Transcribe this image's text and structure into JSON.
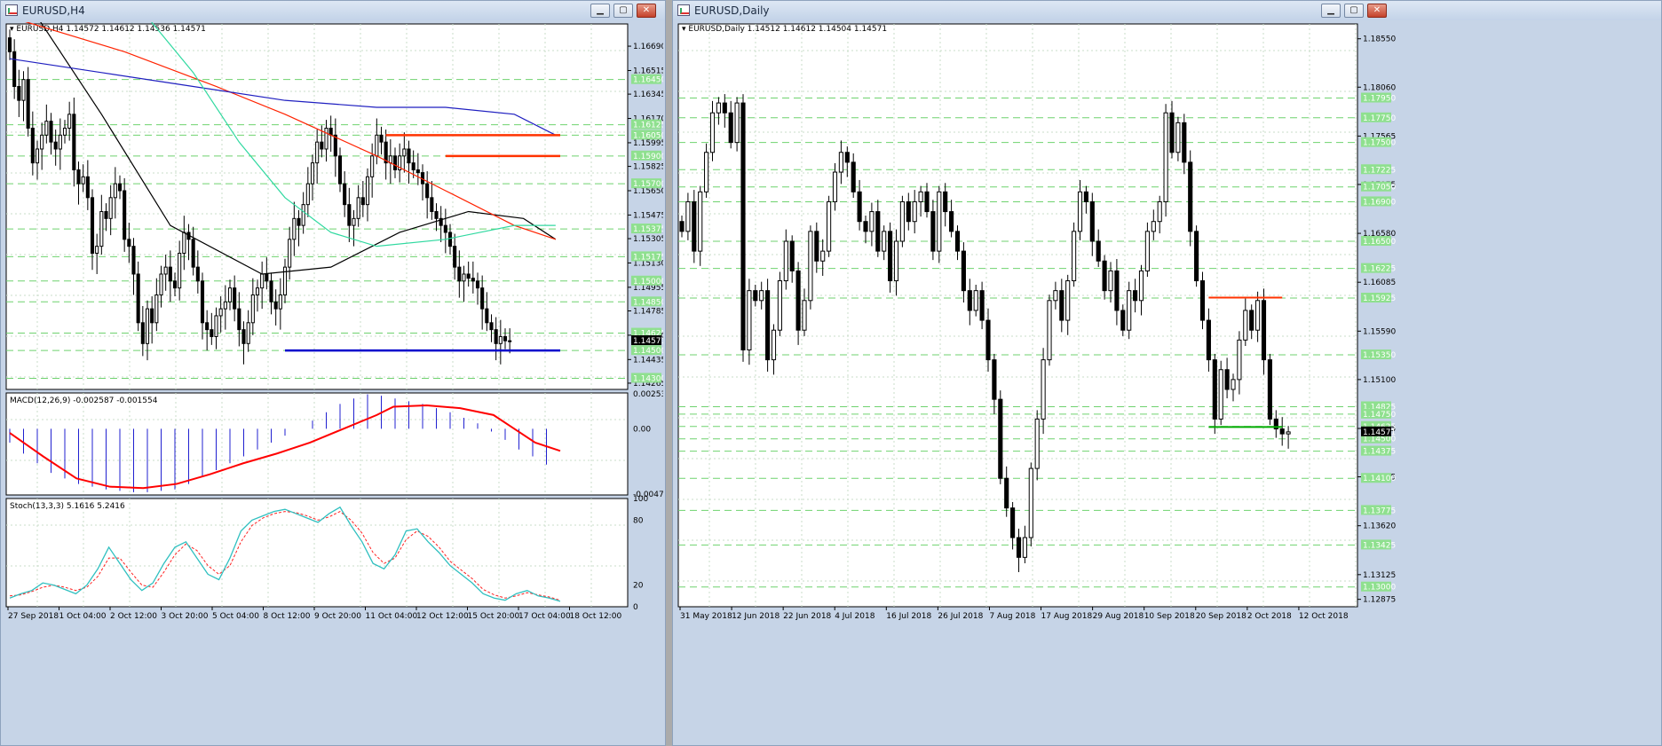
{
  "windows": [
    {
      "title": "EURUSD,H4",
      "min_symbol": "▁",
      "max_symbol": "▢",
      "close_symbol": "✕"
    },
    {
      "title": "EURUSD,Daily",
      "min_symbol": "▁",
      "max_symbol": "▢",
      "close_symbol": "✕"
    }
  ],
  "chart_data": [
    {
      "type": "candlestick",
      "title": "EURUSD,H4  1.14572 1.14612 1.14536 1.14571",
      "symbol": "EURUSD",
      "timeframe": "H4",
      "ohlc_last": {
        "open": 1.14572,
        "high": 1.14612,
        "low": 1.14536,
        "close": 1.14571
      },
      "ylim": [
        1.1422,
        1.1685
      ],
      "price_ticks": [
        "1.16690",
        "1.16515",
        "1.16345",
        "1.16170",
        "1.15995",
        "1.15825",
        "1.15650",
        "1.15475",
        "1.15305",
        "1.15130",
        "1.14955",
        "1.14785",
        "1.14610",
        "1.14435",
        "1.14265"
      ],
      "level_labels": [
        "1.16450",
        "1.16125",
        "1.16050",
        "1.15900",
        "1.15700",
        "1.15375",
        "1.15175",
        "1.15000",
        "1.14850",
        "1.14625",
        "1.14500",
        "1.14300"
      ],
      "current_price": "1.14571",
      "x_labels": [
        "27 Sep 2018",
        "1 Oct 04:00",
        "2 Oct 12:00",
        "3 Oct 20:00",
        "5 Oct 04:00",
        "8 Oct 12:00",
        "9 Oct 20:00",
        "11 Oct 04:00",
        "12 Oct 12:00",
        "15 Oct 20:00",
        "17 Oct 04:00",
        "18 Oct 12:00"
      ],
      "bar_count": 120,
      "candles_close": [
        1.1665,
        1.164,
        1.163,
        1.1645,
        1.161,
        1.1585,
        1.1595,
        1.1605,
        1.1615,
        1.16,
        1.1595,
        1.1605,
        1.161,
        1.162,
        1.158,
        1.157,
        1.1575,
        1.156,
        1.152,
        1.1525,
        1.155,
        1.1545,
        1.156,
        1.157,
        1.1565,
        1.153,
        1.1525,
        1.1505,
        1.147,
        1.1455,
        1.148,
        1.147,
        1.149,
        1.1505,
        1.151,
        1.15,
        1.1495,
        1.152,
        1.1535,
        1.153,
        1.151,
        1.15,
        1.147,
        1.1465,
        1.146,
        1.1475,
        1.148,
        1.1485,
        1.1495,
        1.148,
        1.1465,
        1.1455,
        1.147,
        1.149,
        1.1495,
        1.1505,
        1.15,
        1.1485,
        1.148,
        1.149,
        1.151,
        1.153,
        1.1545,
        1.154,
        1.1555,
        1.157,
        1.1585,
        1.16,
        1.1595,
        1.161,
        1.1605,
        1.159,
        1.157,
        1.1555,
        1.154,
        1.1545,
        1.156,
        1.1555,
        1.1575,
        1.159,
        1.1605,
        1.16,
        1.1585,
        1.159,
        1.158,
        1.159,
        1.1595,
        1.1585,
        1.158,
        1.1578,
        1.157,
        1.156,
        1.155,
        1.1545,
        1.154,
        1.1535,
        1.1525,
        1.151,
        1.15,
        1.1505,
        1.1502,
        1.15,
        1.1495,
        1.148,
        1.147,
        1.1465,
        1.1455,
        1.146,
        1.1457,
        1.1457
      ],
      "overlays": [
        {
          "name": "MA black",
          "color": "#000000",
          "points": [
            [
              0,
              1.172
            ],
            [
              20,
              1.162
            ],
            [
              35,
              1.154
            ],
            [
              55,
              1.1505
            ],
            [
              70,
              1.151
            ],
            [
              85,
              1.1535
            ],
            [
              100,
              1.155
            ],
            [
              112,
              1.1545
            ],
            [
              119,
              1.153
            ]
          ]
        },
        {
          "name": "MA red",
          "color": "#ff2200",
          "points": [
            [
              0,
              1.169
            ],
            [
              25,
              1.1665
            ],
            [
              45,
              1.164
            ],
            [
              60,
              1.162
            ],
            [
              80,
              1.159
            ],
            [
              95,
              1.1565
            ],
            [
              110,
              1.154
            ],
            [
              119,
              1.153
            ]
          ]
        },
        {
          "name": "MA blue",
          "color": "#1f1fc0",
          "points": [
            [
              0,
              1.166
            ],
            [
              20,
              1.165
            ],
            [
              40,
              1.164
            ],
            [
              60,
              1.163
            ],
            [
              80,
              1.1625
            ],
            [
              95,
              1.1625
            ],
            [
              110,
              1.162
            ],
            [
              119,
              1.1605
            ]
          ]
        },
        {
          "name": "MA green",
          "color": "#30d9a0",
          "points": [
            [
              30,
              1.169
            ],
            [
              40,
              1.165
            ],
            [
              50,
              1.16
            ],
            [
              60,
              1.156
            ],
            [
              70,
              1.1535
            ],
            [
              80,
              1.1525
            ],
            [
              95,
              1.153
            ],
            [
              110,
              1.154
            ],
            [
              119,
              1.154
            ]
          ]
        }
      ],
      "hlines": [
        {
          "price": 1.1605,
          "from": 82,
          "to": 120,
          "color": "#ff3300"
        },
        {
          "price": 1.159,
          "from": 95,
          "to": 120,
          "color": "#ff3300"
        },
        {
          "price": 1.145,
          "from": 60,
          "to": 120,
          "color": "#0000cc"
        }
      ]
    },
    {
      "type": "histogram+line",
      "title": "MACD(12,26,9) -0.002587 -0.001554",
      "ylim": [
        -0.0048,
        0.0026
      ],
      "y_ticks": [
        "0.002531",
        "0.00",
        "-0.004734"
      ],
      "histogram": [
        -0.001,
        -0.0018,
        -0.0025,
        -0.0032,
        -0.0036,
        -0.004,
        -0.0042,
        -0.0044,
        -0.0045,
        -0.0046,
        -0.0046,
        -0.0045,
        -0.0044,
        -0.004,
        -0.0035,
        -0.003,
        -0.0025,
        -0.002,
        -0.0015,
        -0.001,
        -0.0005,
        0.0,
        0.0006,
        0.0012,
        0.0018,
        0.0022,
        0.0025,
        0.0024,
        0.0022,
        0.002,
        0.0018,
        0.0015,
        0.0012,
        0.0008,
        0.0004,
        -0.0002,
        -0.0008,
        -0.0015,
        -0.002,
        -0.0026
      ],
      "signal_points": [
        [
          0,
          -0.0003
        ],
        [
          4,
          -0.002
        ],
        [
          8,
          -0.0036
        ],
        [
          12,
          -0.0042
        ],
        [
          16,
          -0.0043
        ],
        [
          20,
          -0.004
        ],
        [
          24,
          -0.0033
        ],
        [
          28,
          -0.0025
        ],
        [
          32,
          -0.0018
        ],
        [
          36,
          -0.001
        ],
        [
          40,
          0.0
        ],
        [
          44,
          0.001
        ],
        [
          46,
          0.0016
        ],
        [
          50,
          0.0017
        ],
        [
          54,
          0.0015
        ],
        [
          58,
          0.001
        ],
        [
          60,
          0.0002
        ],
        [
          63,
          -0.001
        ],
        [
          66,
          -0.0016
        ]
      ],
      "signal_color": "#ff0000",
      "hist_color": "#2020d0"
    },
    {
      "type": "line",
      "title": "Stoch(13,3,3) 5.1616 5.2416",
      "ylim": [
        0,
        100
      ],
      "y_ticks": [
        "100",
        "80",
        "20",
        "0"
      ],
      "k_color": "#30c0c0",
      "d_color": "#ff2020",
      "k": [
        8,
        12,
        15,
        22,
        20,
        16,
        12,
        20,
        35,
        55,
        40,
        25,
        15,
        22,
        40,
        55,
        60,
        45,
        30,
        25,
        45,
        70,
        80,
        84,
        88,
        90,
        86,
        82,
        78,
        86,
        92,
        75,
        60,
        40,
        35,
        48,
        70,
        72,
        60,
        50,
        38,
        30,
        22,
        12,
        8,
        6,
        12,
        15,
        10,
        8,
        5
      ],
      "d": [
        10,
        11,
        14,
        18,
        20,
        18,
        15,
        18,
        28,
        45,
        45,
        32,
        20,
        18,
        32,
        48,
        58,
        52,
        38,
        30,
        38,
        60,
        75,
        82,
        86,
        88,
        87,
        84,
        80,
        83,
        88,
        80,
        68,
        50,
        40,
        45,
        62,
        70,
        65,
        55,
        42,
        34,
        26,
        16,
        11,
        8,
        10,
        13,
        11,
        9,
        6
      ]
    },
    {
      "type": "candlestick",
      "title": "EURUSD,Daily  1.14512 1.14612 1.14504 1.14571",
      "symbol": "EURUSD",
      "timeframe": "Daily",
      "ohlc_last": {
        "open": 1.14512,
        "high": 1.14612,
        "low": 1.14504,
        "close": 1.14571
      },
      "ylim": [
        1.128,
        1.187
      ],
      "price_ticks": [
        "1.18550",
        "1.18060",
        "1.17565",
        "1.17075",
        "1.16580",
        "1.16085",
        "1.15590",
        "1.15100",
        "1.14605",
        "1.14115",
        "1.13620",
        "1.13125",
        "1.12875"
      ],
      "level_labels": [
        "1.17950",
        "1.17750",
        "1.17500",
        "1.17225",
        "1.17050",
        "1.16900",
        "1.16500",
        "1.16225",
        "1.15925",
        "1.15350",
        "1.14825",
        "1.14750",
        "1.14625",
        "1.14500",
        "1.14375",
        "1.14100",
        "1.13775",
        "1.13425",
        "1.13000"
      ],
      "current_price": "1.14571",
      "x_labels": [
        "31 May 2018",
        "12 Jun 2018",
        "22 Jun 2018",
        "4 Jul 2018",
        "16 Jul 2018",
        "26 Jul 2018",
        "7 Aug 2018",
        "17 Aug 2018",
        "29 Aug 2018",
        "10 Sep 2018",
        "20 Sep 2018",
        "2 Oct 2018",
        "12 Oct 2018"
      ],
      "bar_count": 100,
      "candles_close": [
        1.166,
        1.169,
        1.164,
        1.17,
        1.174,
        1.178,
        1.179,
        1.178,
        1.175,
        1.179,
        1.154,
        1.16,
        1.159,
        1.16,
        1.153,
        1.156,
        1.161,
        1.165,
        1.162,
        1.156,
        1.159,
        1.166,
        1.163,
        1.164,
        1.169,
        1.172,
        1.174,
        1.173,
        1.17,
        1.167,
        1.166,
        1.168,
        1.164,
        1.166,
        1.161,
        1.165,
        1.169,
        1.167,
        1.169,
        1.17,
        1.168,
        1.164,
        1.17,
        1.168,
        1.166,
        1.164,
        1.16,
        1.158,
        1.16,
        1.157,
        1.153,
        1.149,
        1.141,
        1.138,
        1.135,
        1.133,
        1.135,
        1.142,
        1.147,
        1.153,
        1.159,
        1.16,
        1.157,
        1.161,
        1.166,
        1.17,
        1.169,
        1.165,
        1.163,
        1.16,
        1.162,
        1.158,
        1.156,
        1.16,
        1.159,
        1.162,
        1.166,
        1.167,
        1.169,
        1.178,
        1.174,
        1.177,
        1.173,
        1.166,
        1.161,
        1.157,
        1.153,
        1.147,
        1.152,
        1.15,
        1.151,
        1.155,
        1.158,
        1.156,
        1.159,
        1.153,
        1.147,
        1.146,
        1.1455,
        1.1457
      ],
      "hlines": [
        {
          "price": 1.1593,
          "from": 86,
          "to": 98,
          "color": "#ff3300"
        },
        {
          "price": 1.1462,
          "from": 86,
          "to": 98,
          "color": "#00aa00"
        }
      ]
    }
  ]
}
